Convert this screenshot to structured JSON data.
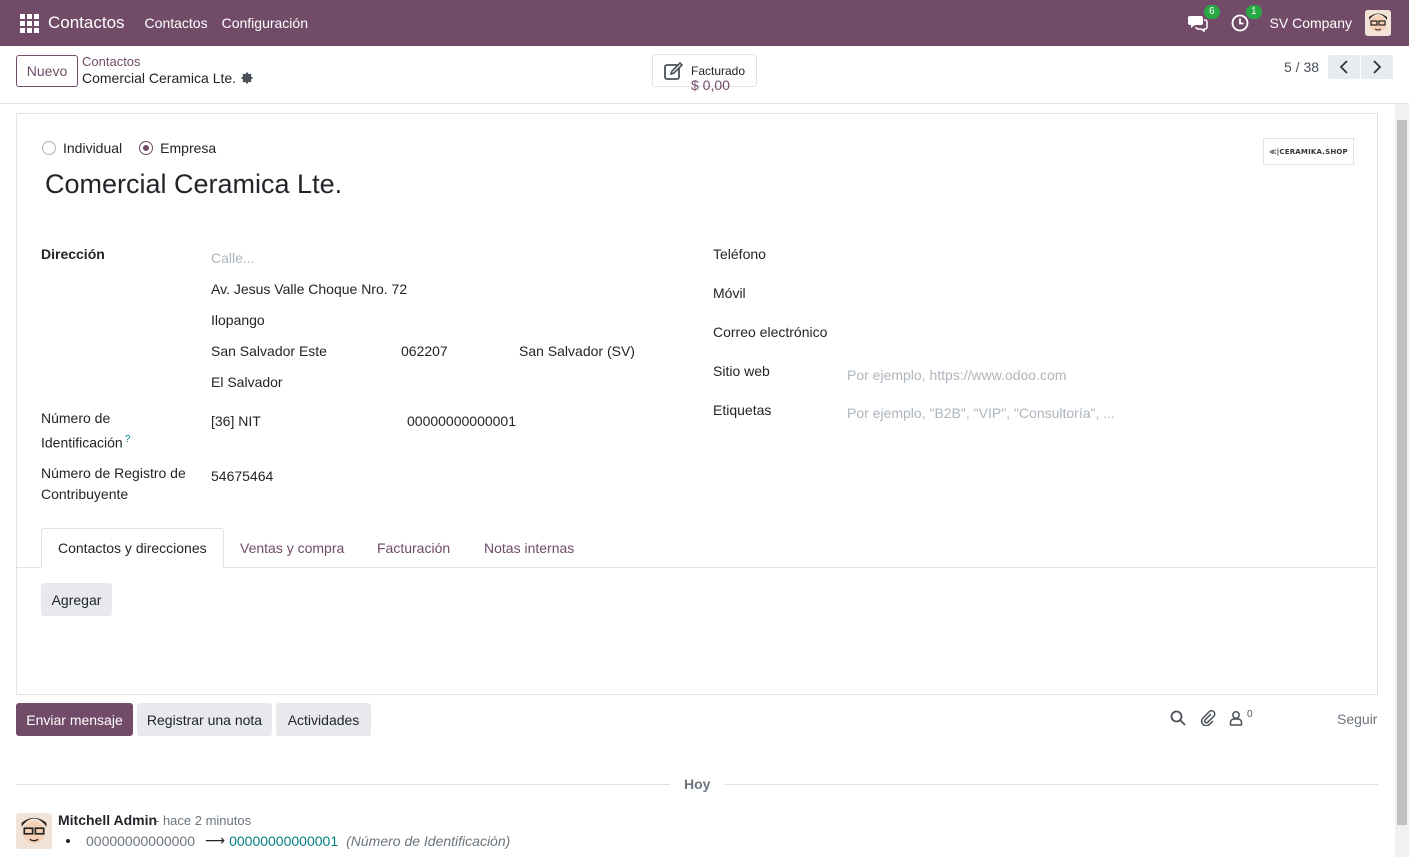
{
  "navbar": {
    "app_name": "Contactos",
    "menus": [
      "Contactos",
      "Configuración"
    ],
    "messages_count": "6",
    "activities_count": "1",
    "company": "SV Company"
  },
  "control": {
    "new_label": "Nuevo",
    "breadcrumb_parent": "Contactos",
    "breadcrumb_current": "Comercial Ceramica Lte.",
    "stat_label": "Facturado",
    "stat_value": "$ 0,00",
    "pager": "5 / 38"
  },
  "form": {
    "type_options": [
      "Individual",
      "Empresa"
    ],
    "selected_type": "Empresa",
    "logo_text": "≪|CERAMIKA.SHOP",
    "name": "Comercial Ceramica Lte.",
    "address": {
      "label": "Dirección",
      "street_placeholder": "Calle...",
      "street2": "Av. Jesus Valle Choque Nro. 72",
      "city": "Ilopango",
      "state": "San Salvador Este",
      "zip": "062207",
      "state2": "San Salvador (SV)",
      "country": "El Salvador"
    },
    "id_number": {
      "label_line1": "Número de",
      "label_line2": "Identificación",
      "help": "?",
      "type": "[36] NIT",
      "value": "00000000000001"
    },
    "tax_reg": {
      "label_line1": "Número de Registro de",
      "label_line2": "Contribuyente",
      "value": "54675464"
    },
    "right": {
      "phone_label": "Teléfono",
      "mobile_label": "Móvil",
      "email_label": "Correo electrónico",
      "website_label": "Sitio web",
      "website_placeholder": "Por ejemplo, https://www.odoo.com",
      "tags_label": "Etiquetas",
      "tags_placeholder": "Por ejemplo, \"B2B\", \"VIP\", \"Consultoría\", ..."
    },
    "tabs": [
      "Contactos y direcciones",
      "Ventas y compra",
      "Facturación",
      "Notas internas"
    ],
    "add_label": "Agregar"
  },
  "chatter": {
    "send_message": "Enviar mensaje",
    "log_note": "Registrar una nota",
    "activities": "Actividades",
    "followers_count": "0",
    "follow": "Seguir",
    "today": "Hoy",
    "message": {
      "author": "Mitchell Admin",
      "time": "- hace 2 minutos",
      "old_value": "00000000000000",
      "arrow": "⟶",
      "new_value": "00000000000001",
      "field": "(Número de Identificación)"
    }
  },
  "colors": {
    "brand": "#714B67",
    "link_teal": "#017e84",
    "badge_green": "#28a745"
  }
}
